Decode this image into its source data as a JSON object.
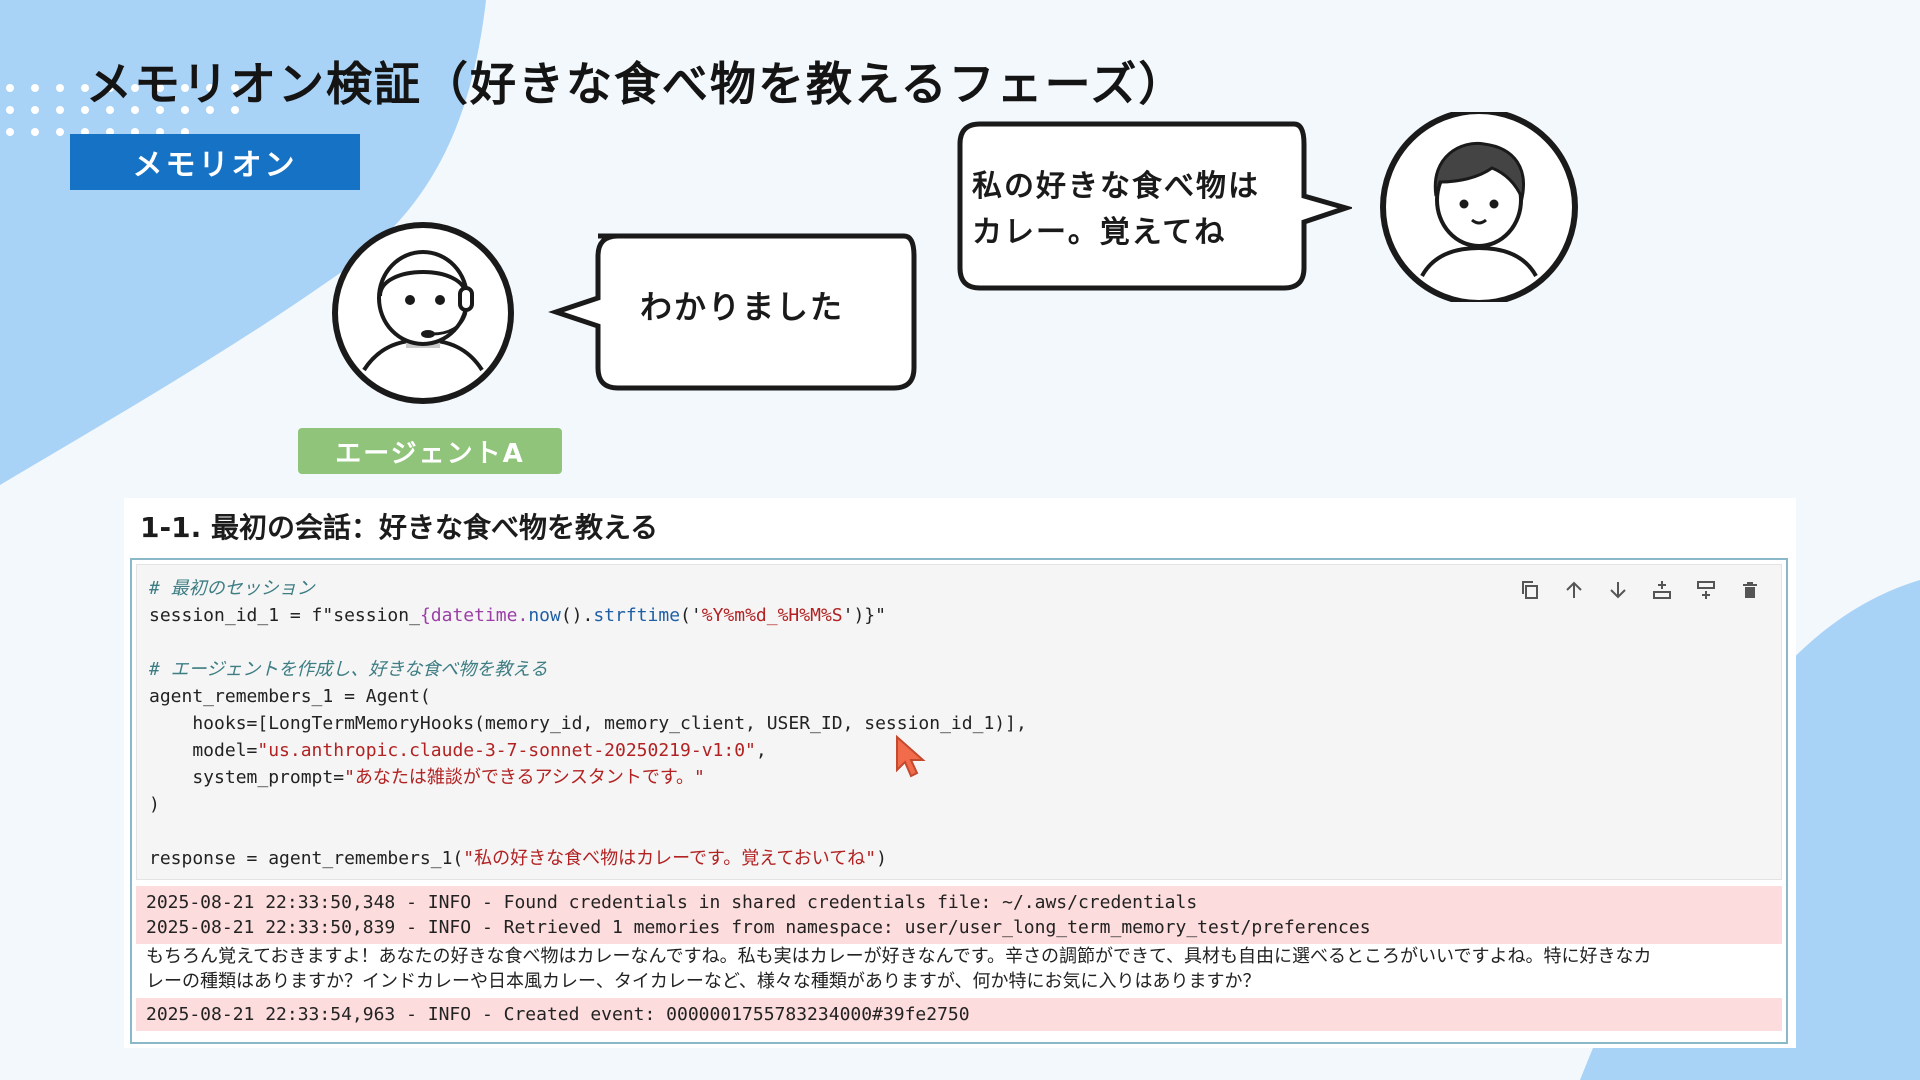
{
  "slide": {
    "title": "メモリオン検証（好きな食べ物を教えるフェーズ）",
    "tag": "メモリオン",
    "agent_label": "エージェントA",
    "colors": {
      "accent_blue": "#1672c4",
      "agent_green": "#8fc47a",
      "bg_blob": "#a9d2f7"
    }
  },
  "bubbles": {
    "agent_reply": "わかりました",
    "user_line1": "私の好きな食べ物は",
    "user_line2": "カレー。覚えてね"
  },
  "notebook": {
    "heading": "1-1. 最初の会話：好きな食べ物を教える",
    "toolbar": [
      "copy-icon",
      "move-up-icon",
      "move-down-icon",
      "insert-above-icon",
      "insert-below-icon",
      "delete-icon"
    ],
    "code": {
      "c1": "# 最初のセッション",
      "l2a": "session_id_1 = f\"session_",
      "l2b": "{datetime.",
      "l2c": "now",
      "l2d": "().",
      "l2e": "strftime",
      "l2f": "('",
      "l2g": "%Y%m%d_%H%M%S",
      "l2h": "')}\"",
      "c2": "# エージェントを作成し、好きな食べ物を教える",
      "l5": "agent_remembers_1 = Agent(",
      "l6": "    hooks=[LongTermMemoryHooks(memory_id, memory_client, USER_ID, session_id_1)],",
      "l7a": "    model=",
      "l7b": "\"us.anthropic.claude-3-7-sonnet-20250219-v1:0\"",
      "l7c": ",",
      "l8a": "    system_prompt=",
      "l8b": "\"あなたは雑談ができるアシスタントです。\"",
      "l9": ")",
      "l11a": "response = agent_remembers_1(",
      "l11b": "\"私の好きな食べ物はカレーです。覚えておいてね\"",
      "l11c": ")"
    },
    "output": {
      "log1": "2025-08-21 22:33:50,348 - INFO - Found credentials in shared credentials file: ~/.aws/credentials",
      "log2": "2025-08-21 22:33:50,839 - INFO - Retrieved 1 memories from namespace: user/user_long_term_memory_test/preferences",
      "reply1": "もちろん覚えておきますよ！あなたの好きな食べ物はカレーなんですね。私も実はカレーが好きなんです。辛さの調節ができて、具材も自由に選べるところがいいですよね。特に好きなカ",
      "reply2": "レーの種類はありますか？インドカレーや日本風カレー、タイカレーなど、様々な種類がありますが、何か特にお気に入りはありますか？",
      "log3": "2025-08-21 22:33:54,963 - INFO - Created event: 0000001755783234000#39fe2750"
    }
  }
}
